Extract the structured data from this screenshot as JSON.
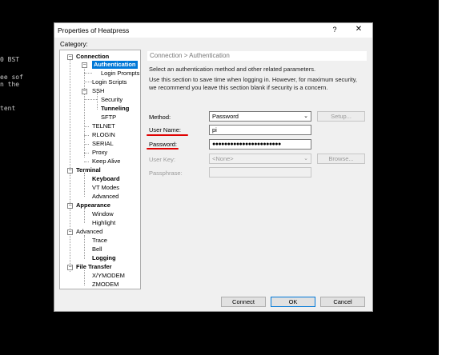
{
  "terminal": {
    "lines": [
      "0 BST",
      "ee sof",
      "n the",
      "tent"
    ]
  },
  "dialog": {
    "title": "Properties of Heatpress",
    "help": "?",
    "close": "✕",
    "category_label": "Category:",
    "tree": {
      "connection": "Connection",
      "authentication": "Authentication",
      "login_prompts": "Login Prompts",
      "login_scripts": "Login Scripts",
      "ssh": "SSH",
      "security": "Security",
      "tunneling": "Tunneling",
      "sftp": "SFTP",
      "telnet": "TELNET",
      "rlogin": "RLOGIN",
      "serial": "SERIAL",
      "proxy": "Proxy",
      "keep_alive": "Keep Alive",
      "terminal": "Terminal",
      "keyboard": "Keyboard",
      "vt_modes": "VT Modes",
      "advanced_terminal": "Advanced",
      "appearance": "Appearance",
      "window": "Window",
      "highlight": "Highlight",
      "advanced": "Advanced",
      "trace": "Trace",
      "bell": "Bell",
      "logging": "Logging",
      "file_transfer": "File Transfer",
      "xymodem": "X/YMODEM",
      "zmodem": "ZMODEM"
    },
    "panel": {
      "header": "Connection > Authentication",
      "desc1": "Select an authentication method and other related parameters.",
      "desc2": "Use this section to save time when logging in. However, for maximum security,",
      "desc3": "we recommend you leave this section blank if security is a concern.",
      "method_label": "Method:",
      "method_value": "Password",
      "setup_button": "Setup...",
      "username_label": "User Name:",
      "username_value": "pi",
      "password_label": "Password:",
      "password_value": "●●●●●●●●●●●●●●●●●●●●●●●",
      "userkey_label": "User Key:",
      "userkey_value": "<None>",
      "browse_button": "Browse...",
      "passphrase_label": "Passphrase:"
    },
    "buttons": {
      "connect": "Connect",
      "ok": "OK",
      "cancel": "Cancel"
    }
  }
}
